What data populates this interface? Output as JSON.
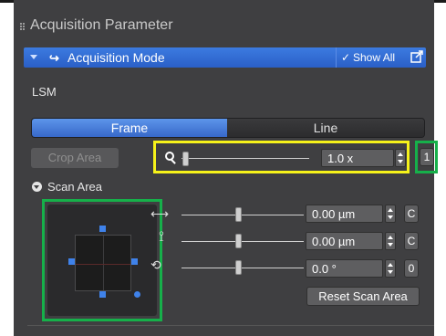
{
  "section": {
    "title": "Acquisition Parameter"
  },
  "mode_bar": {
    "title": "Acquisition Mode",
    "show_all": "Show All",
    "show_all_check": "✓"
  },
  "lsm_label": "LSM",
  "tabs": [
    {
      "label": "Frame",
      "active": true
    },
    {
      "label": "Line",
      "active": false
    }
  ],
  "crop_area": "Crop Area",
  "zoom": {
    "value": "1.0 x",
    "one_button": "1"
  },
  "scan_area": {
    "title": "Scan Area",
    "offset_x": {
      "value": "0.00 µm",
      "button": "C"
    },
    "offset_y": {
      "value": "0.00 µm",
      "button": "C"
    },
    "rotation": {
      "value": "0.0 °",
      "button": "0"
    },
    "reset_button": "Reset Scan Area"
  },
  "colors": {
    "accent": "#2f6bd8",
    "highlight_yellow": "#f6f21a",
    "highlight_green": "#16b04a",
    "panel_bg": "#3f3f41"
  },
  "icons": [
    "grip-icon",
    "collapse-icon",
    "loop-icon",
    "check-icon",
    "popout-icon",
    "zoom-icon",
    "expand-icon",
    "horizontal-arrow-icon",
    "vertical-arrow-icon",
    "rotate-icon"
  ]
}
